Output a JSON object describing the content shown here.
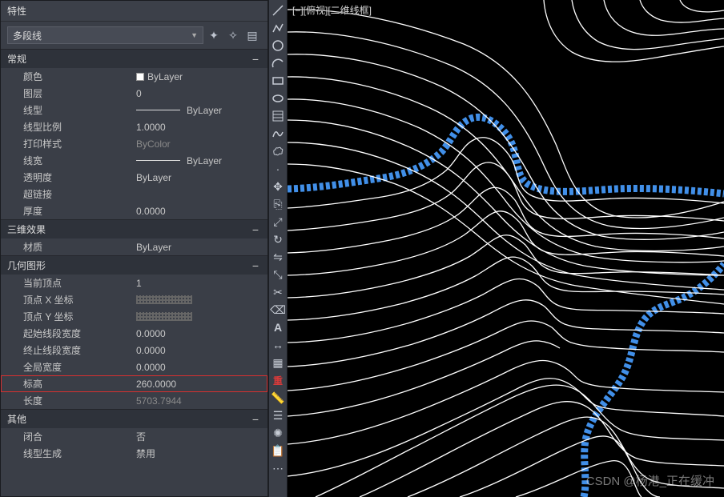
{
  "panel": {
    "title": "特性"
  },
  "selector": {
    "object_type": "多段线"
  },
  "cats": {
    "general": {
      "label": "常规"
    },
    "effect3d": {
      "label": "三维效果"
    },
    "geometry": {
      "label": "几何图形"
    },
    "other": {
      "label": "其他"
    }
  },
  "general": {
    "color": {
      "label": "颜色",
      "value": "ByLayer"
    },
    "layer": {
      "label": "图层",
      "value": "0"
    },
    "linetype": {
      "label": "线型",
      "value": "ByLayer"
    },
    "ltscale": {
      "label": "线型比例",
      "value": "1.0000"
    },
    "plotstyle": {
      "label": "打印样式",
      "value": "ByColor"
    },
    "lineweight": {
      "label": "线宽",
      "value": "ByLayer"
    },
    "transparency": {
      "label": "透明度",
      "value": "ByLayer"
    },
    "hyperlink": {
      "label": "超链接",
      "value": ""
    },
    "thickness": {
      "label": "厚度",
      "value": "0.0000"
    }
  },
  "effect3d": {
    "material": {
      "label": "材质",
      "value": "ByLayer"
    }
  },
  "geometry": {
    "current_vertex": {
      "label": "当前顶点",
      "value": "1"
    },
    "vertex_x": {
      "label": "顶点 X 坐标",
      "value": ""
    },
    "vertex_y": {
      "label": "顶点 Y 坐标",
      "value": ""
    },
    "start_width": {
      "label": "起始线段宽度",
      "value": "0.0000"
    },
    "end_width": {
      "label": "终止线段宽度",
      "value": "0.0000"
    },
    "global_width": {
      "label": "全局宽度",
      "value": "0.0000"
    },
    "elevation": {
      "label": "标高",
      "value": "260.0000"
    },
    "length": {
      "label": "长度",
      "value": "5703.7944"
    }
  },
  "other": {
    "closed": {
      "label": "闭合",
      "value": "否"
    },
    "ltgen": {
      "label": "线型生成",
      "value": "禁用"
    }
  },
  "viewport": {
    "label": "[−][俯视][二维线框]"
  },
  "redchar": "重",
  "watermark": "CSDN @杨港_正在缓冲"
}
